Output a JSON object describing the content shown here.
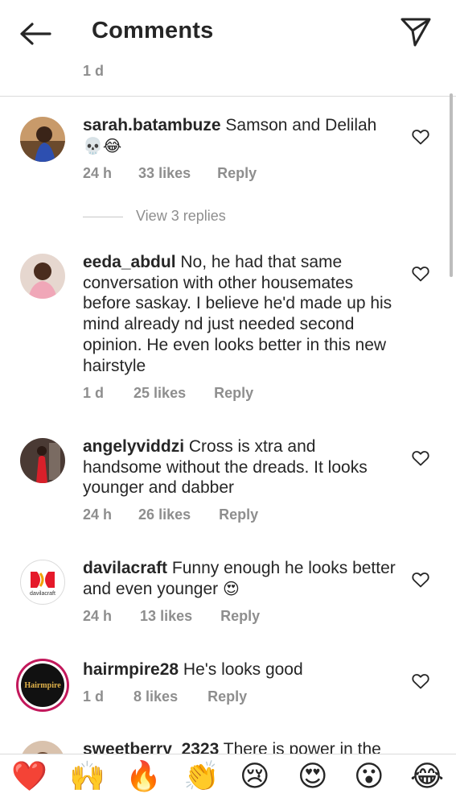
{
  "header": {
    "title": "Comments",
    "back_icon": "back-arrow-icon",
    "send_icon": "direct-send-icon"
  },
  "previous_comment": {
    "time": "1 d"
  },
  "comments": [
    {
      "username": "sarah.batambuze",
      "text": "Samson and Delilah",
      "emoji": "💀😂",
      "time": "24 h",
      "likes": "33 likes",
      "reply": "Reply"
    },
    {
      "username": "eeda_abdul",
      "text": "No, he had that same conversation with other housemates before saskay. I believe he'd made up his mind already nd just needed second opinion. He even looks better in this new hairstyle",
      "time": "1 d",
      "likes": "25 likes",
      "reply": "Reply"
    },
    {
      "username": "angelyviddzi",
      "text": "Cross is xtra and handsome without the dreads. It looks younger and dabber",
      "time": "24 h",
      "likes": "26 likes",
      "reply": "Reply"
    },
    {
      "username": "davilacraft",
      "text": "Funny enough he looks better and even younger",
      "emoji": "😍",
      "time": "24 h",
      "likes": "13 likes",
      "reply": "Reply",
      "avatar_text": "davilacraft"
    },
    {
      "username": "hairmpire28",
      "text": "He's looks good",
      "time": "1 d",
      "likes": "8 likes",
      "reply": "Reply",
      "avatar_text": "Hairmpire"
    },
    {
      "username": "sweetberry_2323",
      "text": "There is power in the"
    }
  ],
  "view_replies": "View 3 replies",
  "reactions": [
    "❤️",
    "🙌",
    "🔥",
    "👏",
    "😢",
    "😍",
    "😮",
    "😂"
  ],
  "colors": {
    "text": "#262626",
    "secondary": "#8e8e8e",
    "divider": "#dbdbdb",
    "heart_red": "#ed4956"
  }
}
